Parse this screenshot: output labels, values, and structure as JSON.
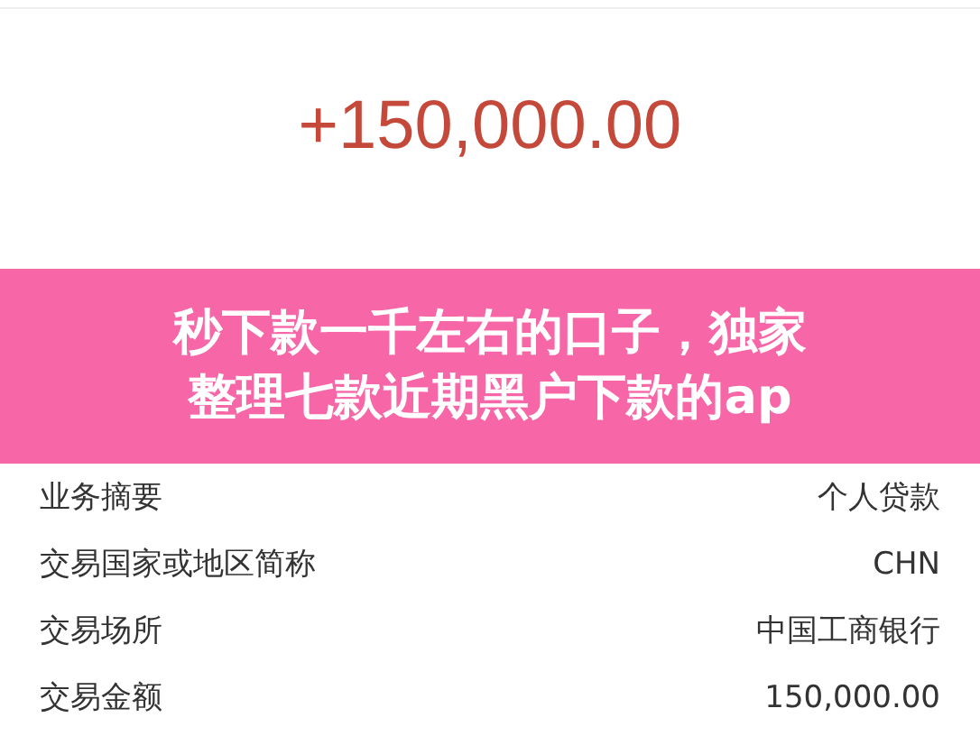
{
  "amount": "+150,000.00",
  "banner": {
    "lines": [
      "秒下款一千左右的口子，独家",
      "整理七款近期黑户下款的ap"
    ]
  },
  "rows": [
    {
      "label": "业务摘要",
      "value": "个人贷款"
    },
    {
      "label": "交易国家或地区简称",
      "value": "CHN"
    },
    {
      "label": "交易场所",
      "value": "中国工商银行"
    },
    {
      "label": "交易金额",
      "value": "150,000.00"
    }
  ]
}
